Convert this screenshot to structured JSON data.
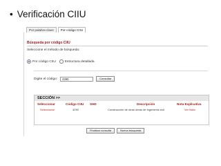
{
  "slide": {
    "bullet": "•",
    "title": "Verificación CIIU"
  },
  "tabs": [
    {
      "label": "Por palabra clave"
    },
    {
      "label": "Por código CIIU"
    }
  ],
  "panel": {
    "title": "Búsqueda por código CIIU",
    "method_label": "Seleccione el método de búsqueda:",
    "dots": ":\n:\n.",
    "radio_options": [
      {
        "label": "Por código CIIU",
        "checked": true
      },
      {
        "label": "Estructura detallada",
        "checked": false
      }
    ],
    "code_label": "Digite el código:",
    "code_value": "4290",
    "consult_button": "Consultar"
  },
  "results": {
    "section_label": "SECCIÓN >>",
    "columns": [
      "Seleccionar",
      "Código CIIU",
      "SHD",
      "Descripción",
      "Nota Explicativa"
    ],
    "rows": [
      {
        "select": "Seleccionar",
        "code": "4290",
        "shd": "",
        "description": "Construcción de otras obras de ingeniería civil",
        "note": "Ver Nota"
      }
    ]
  },
  "bottom_buttons": {
    "finish": "Finalizar consulta",
    "new_search": "Nueva búsqueda"
  },
  "colors": {
    "accent": "#9b1b1b",
    "link": "#b22222",
    "header_bg": "#e6e6e6"
  }
}
